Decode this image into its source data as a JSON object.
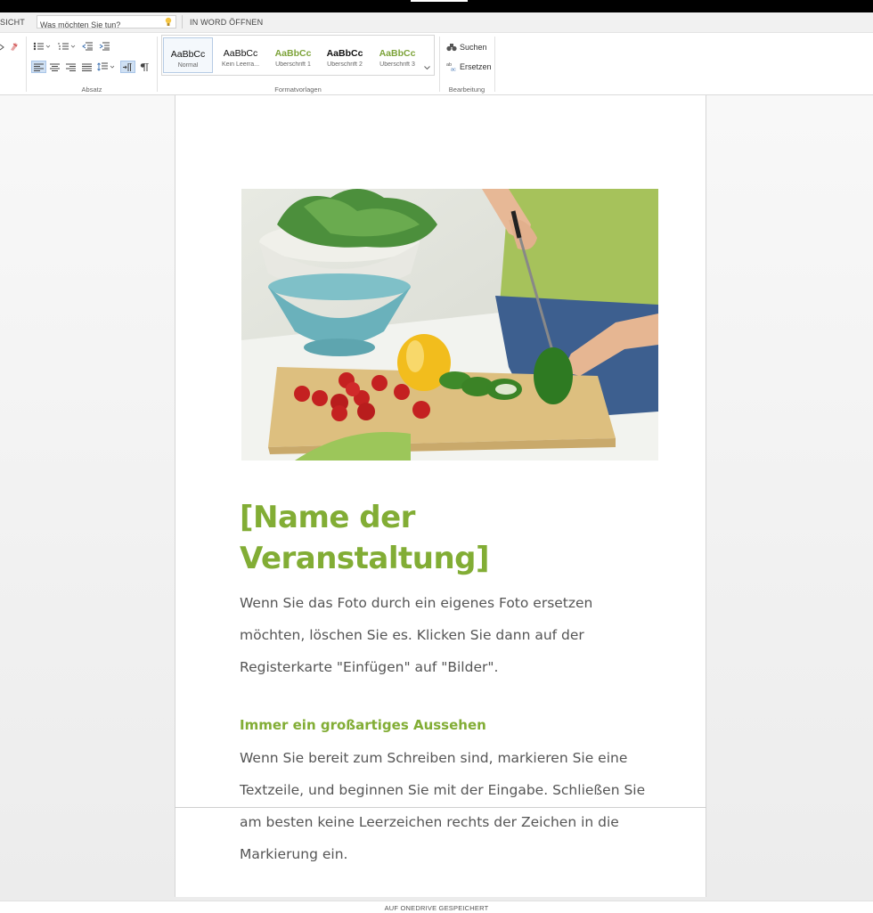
{
  "menubar": {
    "view_tab": "SICHT",
    "search_placeholder": "Was möchten Sie tun?",
    "open_in_word": "IN WORD ÖFFNEN"
  },
  "ribbon": {
    "groups": {
      "paragraph": "Absatz",
      "styles": "Formatvorlagen",
      "editing": "Bearbeitung"
    },
    "styles": [
      {
        "sample": "AaBbCc",
        "name": "Normal"
      },
      {
        "sample": "AaBbCc",
        "name": "Kein Leerra..."
      },
      {
        "sample": "AaBbCc",
        "name": "Überschrift 1"
      },
      {
        "sample": "AaBbCc",
        "name": "Überschrift 2"
      },
      {
        "sample": "AaBbCc",
        "name": "Überschrift 3"
      }
    ],
    "editing": {
      "find": "Suchen",
      "replace": "Ersetzen"
    }
  },
  "document": {
    "title": "[Name der Veranstaltung]",
    "paragraph1": "Wenn Sie das Foto durch ein eigenes Foto ersetzen möchten, löschen Sie es. Klicken Sie dann auf der Registerkarte \"Einfügen\" auf \"Bilder\".",
    "subheading": "Immer ein großartiges Aussehen",
    "paragraph2": "Wenn Sie bereit zum Schreiben sind, markieren Sie eine Textzeile, und beginnen Sie mit der Eingabe. Schließen Sie am besten keine Leerzeichen rechts der Zeichen in die Markierung ein."
  },
  "status": {
    "saved": "AUF ONEDRIVE GESPEICHERT"
  },
  "colors": {
    "accent_green": "#82ad35",
    "body_text": "#555555"
  }
}
